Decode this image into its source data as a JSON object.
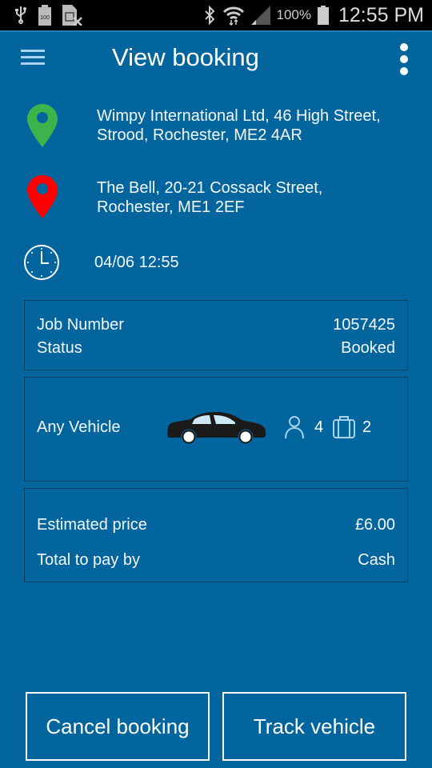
{
  "status_bar": {
    "left_icons": [
      "usb-icon",
      "battery-100-icon",
      "no-sim-icon"
    ],
    "right_icons": [
      "bluetooth-icon",
      "wifi-icon",
      "signal-icon",
      "battery-icon"
    ],
    "battery_percent": "100%",
    "time": "12:55 PM"
  },
  "app_bar": {
    "title": "View booking",
    "menu_icon": "hamburger-menu-icon",
    "overflow_icon": "more-vert-icon"
  },
  "pickup": {
    "icon": "green-location-pin-icon",
    "address_line1": "Wimpy International Ltd, 46 High Street,",
    "address_line2": "Strood, Rochester, ME2 4AR",
    "color": "#3cb44b"
  },
  "dropoff": {
    "icon": "red-location-pin-icon",
    "address_line1": "The Bell, 20-21 Cossack Street,",
    "address_line2": "Rochester, ME1 2EF",
    "color": "#ff0000"
  },
  "pickup_time": {
    "icon": "clock-icon",
    "value": "04/06 12:55"
  },
  "job_card": {
    "job_number_label": "Job Number",
    "job_number": "1057425",
    "status_label": "Status",
    "status": "Booked"
  },
  "vehicle_card": {
    "vehicle_type": "Any Vehicle",
    "vehicle_icon": "car-icon",
    "passenger_icon": "person-icon",
    "passengers": "4",
    "luggage_icon": "suitcase-icon",
    "luggage": "2"
  },
  "price_card": {
    "estimated_price_label": "Estimated price",
    "estimated_price": "£6.00",
    "pay_by_label": "Total to pay by",
    "pay_by": "Cash"
  },
  "actions": {
    "cancel_label": "Cancel booking",
    "track_label": "Track vehicle"
  },
  "colors": {
    "background": "#03659d",
    "card_border": "#0b3f63",
    "accent_light": "#a6d3ef"
  }
}
